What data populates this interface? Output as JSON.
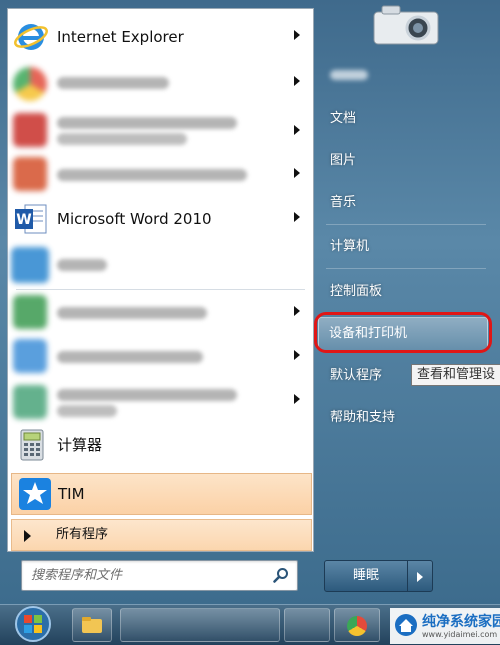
{
  "left_panel": {
    "programs": [
      {
        "label": "Internet Explorer",
        "icon": "internet-explorer-icon",
        "has_submenu": true
      },
      {
        "label": "",
        "icon": "chrome-icon",
        "has_submenu": true,
        "blurred": true
      },
      {
        "label": "",
        "icon": "autocad-icon",
        "has_submenu": true,
        "blurred": true
      },
      {
        "label": "",
        "icon": "powerpoint-icon",
        "has_submenu": true,
        "blurred": true
      },
      {
        "label": "Microsoft Word 2010",
        "icon": "word-icon",
        "has_submenu": true
      },
      {
        "label": "",
        "icon": "blurred-app-icon",
        "has_submenu": false,
        "blurred": true
      },
      {
        "label": "",
        "icon": "excel-icon",
        "has_submenu": true,
        "blurred": true
      },
      {
        "label": "",
        "icon": "photo-viewer-icon",
        "has_submenu": true,
        "blurred": true
      },
      {
        "label": "",
        "icon": "blurred-app-icon",
        "has_submenu": true,
        "blurred": true
      },
      {
        "label": "计算器",
        "icon": "calculator-icon",
        "has_submenu": false
      }
    ],
    "pinned_highlight": {
      "label": "TIM",
      "icon": "tim-icon"
    },
    "all_programs": {
      "label": "所有程序"
    },
    "search": {
      "placeholder": "搜索程序和文件"
    }
  },
  "right_panel": {
    "items": [
      {
        "label": "文档"
      },
      {
        "label": "图片"
      },
      {
        "label": "音乐"
      },
      {
        "label": "计算机"
      },
      {
        "label": "控制面板"
      },
      {
        "label": "设备和打印机"
      },
      {
        "label": "默认程序"
      },
      {
        "label": "帮助和支持"
      }
    ],
    "tooltip": "查看和管理设"
  },
  "shutdown": {
    "label": "睡眠"
  },
  "watermark": {
    "title": "纯净系统家园",
    "url": "www.yidaimei.com"
  },
  "colors": {
    "highlight_ring": "#e01616",
    "tim_bg": "#fbd1a6",
    "panel_blue": "#3f6a8c"
  }
}
